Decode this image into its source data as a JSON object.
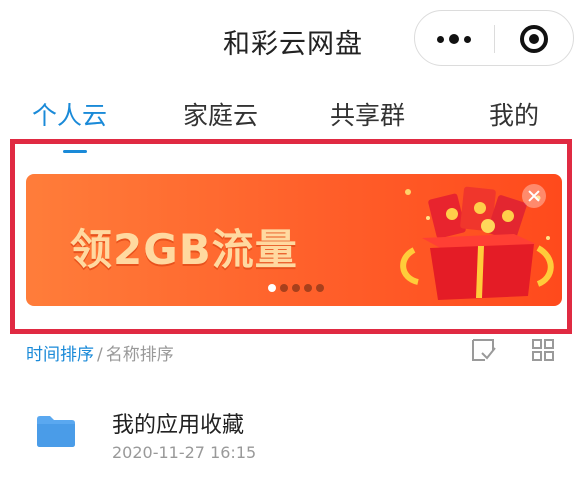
{
  "header": {
    "title": "和彩云网盘"
  },
  "tabs": [
    {
      "label": "个人云",
      "active": true
    },
    {
      "label": "家庭云",
      "active": false
    },
    {
      "label": "共享群",
      "active": false
    },
    {
      "label": "我的",
      "active": false
    }
  ],
  "banner": {
    "text": "领2GB流量",
    "slide_count": 5,
    "active_slide": 1
  },
  "sort": {
    "time_label": "时间排序",
    "separator": "/",
    "name_label": "名称排序"
  },
  "files": [
    {
      "name": "我的应用收藏",
      "time": "2020-11-27 16:15",
      "icon": "folder-icon"
    }
  ],
  "colors": {
    "accent": "#1a8ad8",
    "highlight_border": "#e02a42",
    "banner": "#ff5f2a",
    "folder": "#5aa8f0"
  }
}
